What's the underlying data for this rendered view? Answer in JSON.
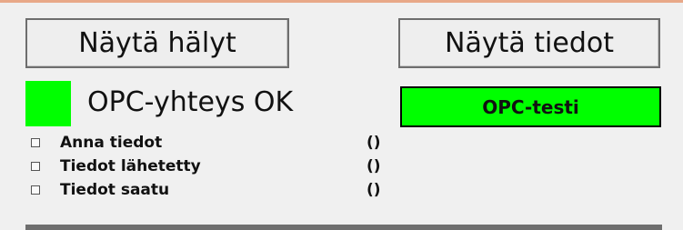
{
  "buttons": {
    "show_alarms": "Näytä hälyt",
    "show_data": "Näytä tiedot",
    "opc_test": "OPC-testi"
  },
  "connection": {
    "status_text": "OPC-yhteys OK",
    "indicator_color": "#00ff00"
  },
  "status_items": [
    {
      "label": "Anna tiedot",
      "value": "()"
    },
    {
      "label": "Tiedot lähetetty",
      "value": "()"
    },
    {
      "label": "Tiedot saatu",
      "value": "()"
    }
  ],
  "colors": {
    "accent_green": "#00ff00",
    "top_border": "#e8a888",
    "background": "#f0f0f0"
  }
}
